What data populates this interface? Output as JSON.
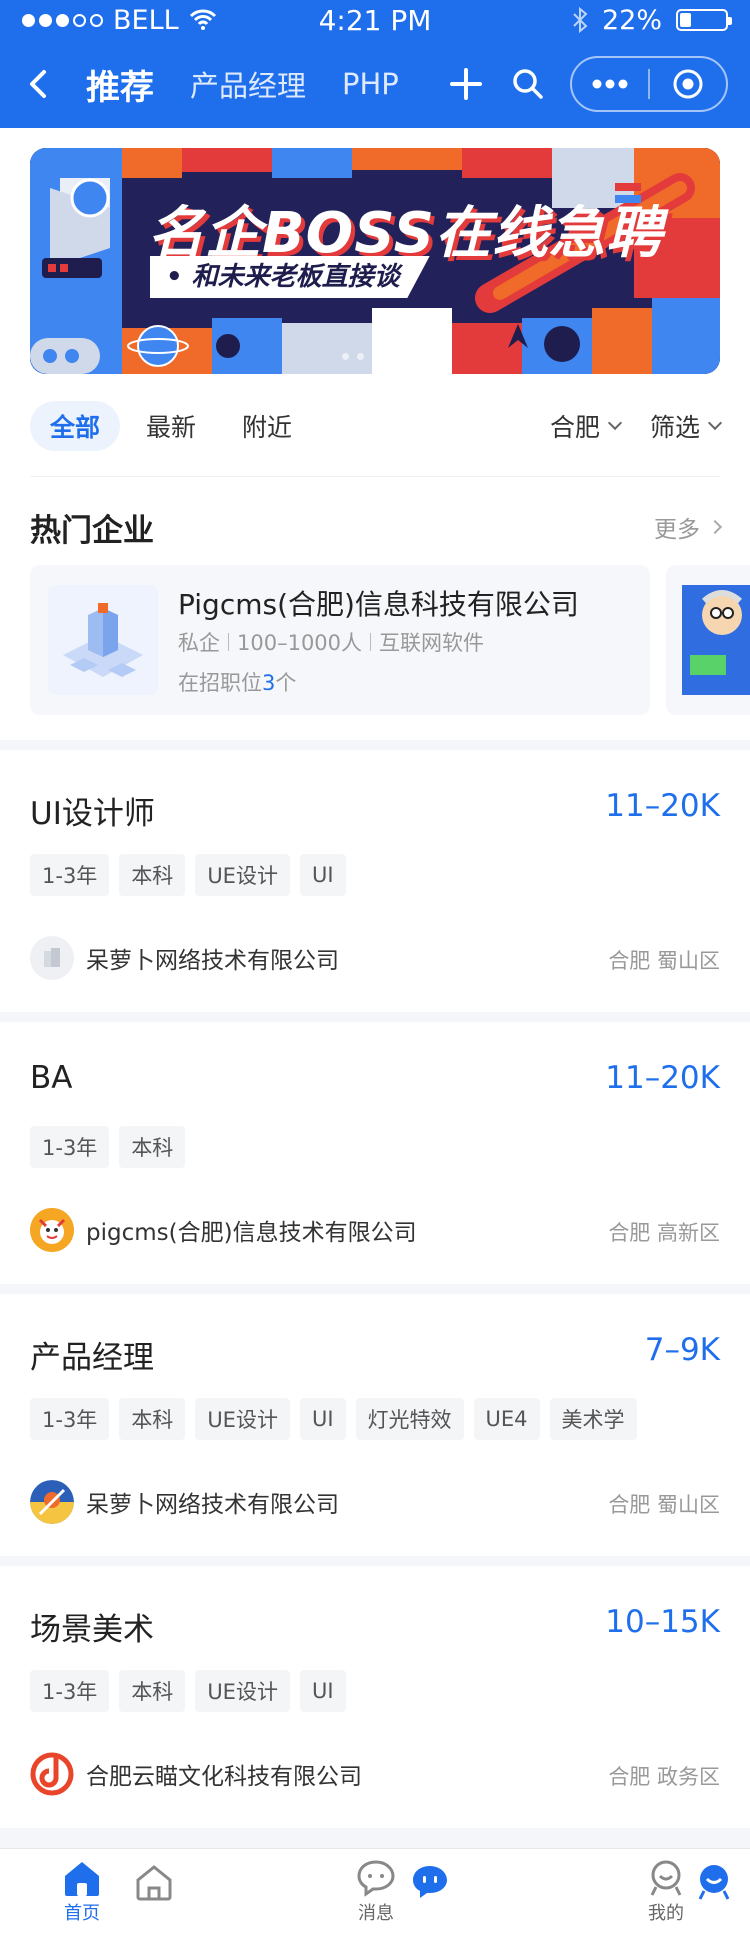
{
  "status": {
    "carrier": "BELL",
    "time": "4:21 PM",
    "battery": "22%"
  },
  "navbar": {
    "tabs": [
      "推荐",
      "产品经理",
      "PHP"
    ]
  },
  "banner": {
    "title": "名企BOSS在线急聘",
    "subtitle": "• 和未来老板直接谈"
  },
  "filters": {
    "pills": [
      "全部",
      "最新",
      "附近"
    ],
    "city": "合肥",
    "screen": "筛选"
  },
  "hot": {
    "title": "热门企业",
    "more": "更多",
    "company": {
      "name": "Pigcms(合肥)信息科技有限公司",
      "type": "私企",
      "size": "100–1000人",
      "industry": "互联网软件",
      "jobs_prefix": "在招职位",
      "jobs_count": "3",
      "jobs_suffix": "个"
    }
  },
  "jobs": [
    {
      "title": "UI设计师",
      "salary": "11–20K",
      "tags": [
        "1-3年",
        "本科",
        "UE设计",
        "UI"
      ],
      "company": "呆萝卜网络技术有限公司",
      "location": "合肥  蜀山区"
    },
    {
      "title": "BA",
      "salary": "11–20K",
      "tags": [
        "1-3年",
        "本科"
      ],
      "company": "pigcms(合肥)信息技术有限公司",
      "location": "合肥  高新区"
    },
    {
      "title": "产品经理",
      "salary": "7–9K",
      "tags": [
        "1-3年",
        "本科",
        "UE设计",
        "UI",
        "灯光特效",
        "UE4",
        "美术学"
      ],
      "company": "呆萝卜网络技术有限公司",
      "location": "合肥  蜀山区"
    },
    {
      "title": "场景美术",
      "salary": "10–15K",
      "tags": [
        "1-3年",
        "本科",
        "UE设计",
        "UI"
      ],
      "company": "合肥云瞄文化科技有限公司",
      "location": "合肥  政务区"
    }
  ],
  "tabbar": {
    "home": "首页",
    "messages": "消息",
    "mine": "我的"
  },
  "colors": {
    "primary": "#1f6fed",
    "salary": "#1f6fed"
  }
}
